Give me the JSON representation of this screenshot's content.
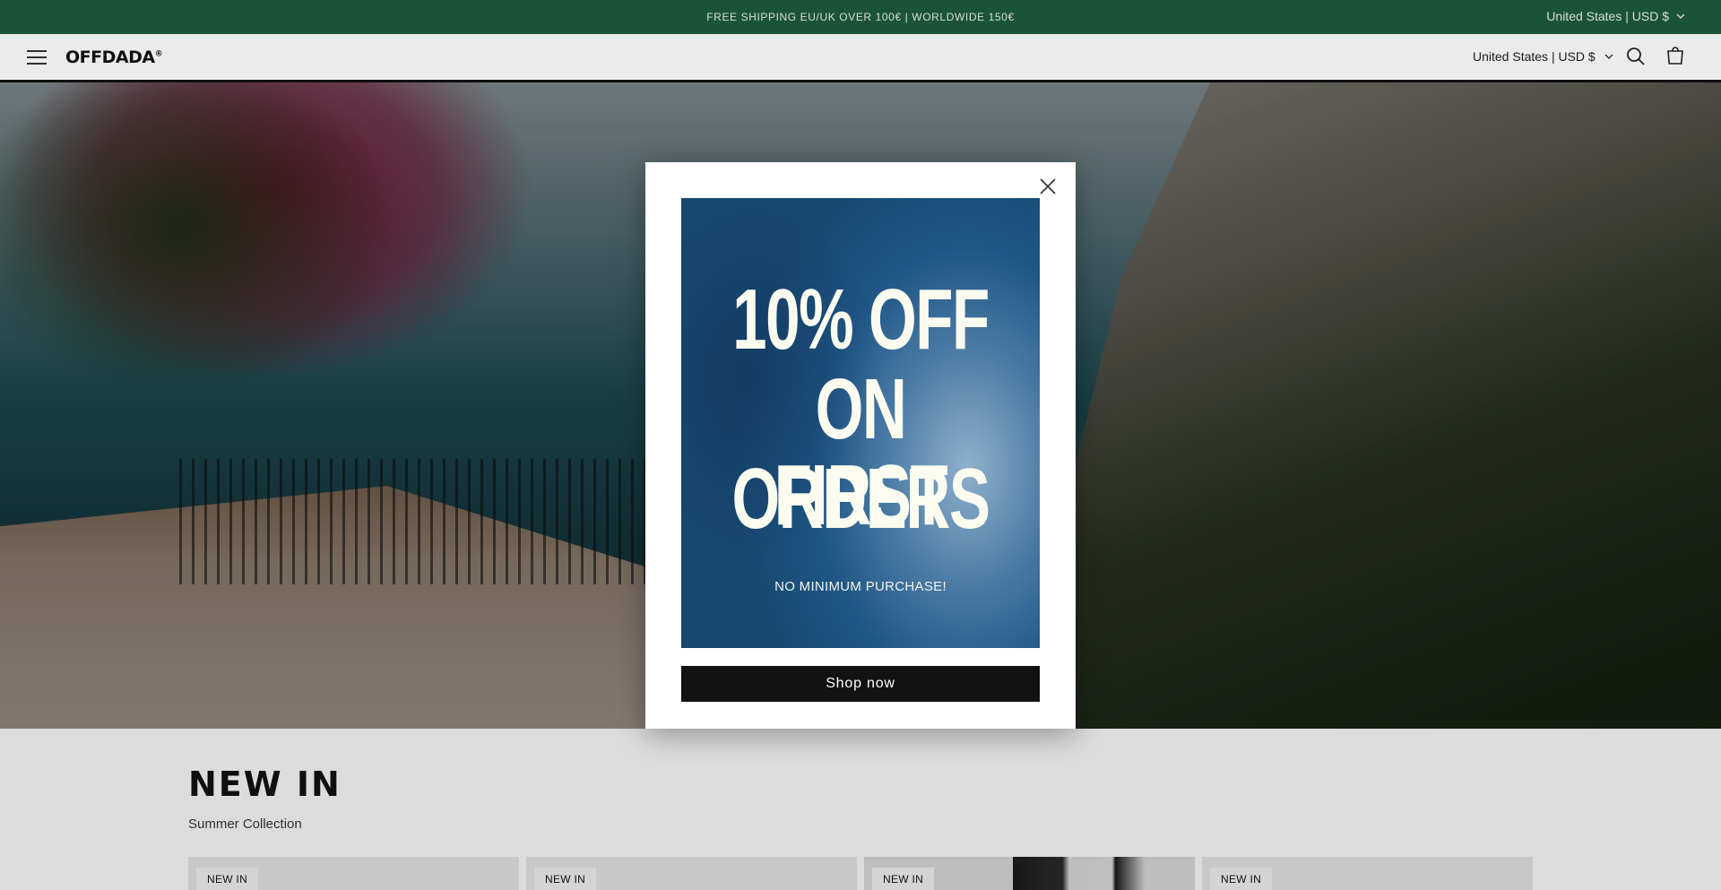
{
  "announcement": {
    "text": "FREE SHIPPING EU/UK OVER 100€ | WORLDWIDE 150€",
    "locale": "United States | USD $"
  },
  "header": {
    "logo": "OFFDADA",
    "logo_mark": "®",
    "locale": "United States | USD $",
    "icons": [
      "menu-icon",
      "search-icon",
      "cart-icon"
    ]
  },
  "section": {
    "title": "NEW IN",
    "subtitle": "Summer Collection",
    "cards": [
      {
        "badge": "NEW IN"
      },
      {
        "badge": "NEW IN"
      },
      {
        "badge": "NEW IN"
      },
      {
        "badge": "NEW IN"
      }
    ]
  },
  "popup": {
    "promo_lines": [
      "10% OFF",
      "ON FIRST",
      "ORDERS"
    ],
    "promo_subtext": "NO MINIMUM PURCHASE!",
    "button_label": "Shop now"
  },
  "colors": {
    "announcement_bg": "#1e5b3e",
    "button_bg": "#121212",
    "promo_blue": "#1f5685"
  }
}
